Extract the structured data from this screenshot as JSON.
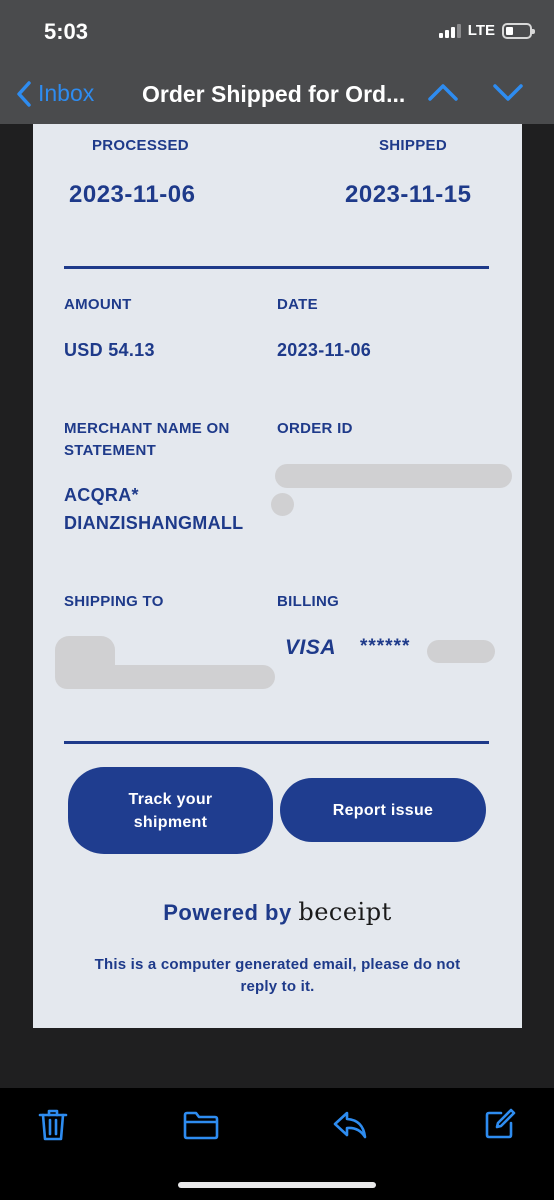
{
  "status_bar": {
    "time": "5:03",
    "network": "LTE"
  },
  "nav": {
    "back_label": "Inbox",
    "title": "Order Shipped for Ord..."
  },
  "email": {
    "processed": {
      "label": "PROCESSED",
      "value": "2023-11-06"
    },
    "shipped": {
      "label": "SHIPPED",
      "value": "2023-11-15"
    },
    "amount": {
      "label": "AMOUNT",
      "value": "USD 54.13"
    },
    "date": {
      "label": "DATE",
      "value": "2023-11-06"
    },
    "merchant": {
      "label_line1": "MERCHANT NAME ON",
      "label_line2": "STATEMENT",
      "value_line1": "ACQRA*",
      "value_line2": "DIANZISHANGMALL"
    },
    "order_id": {
      "label": "ORDER ID"
    },
    "shipping": {
      "label": "SHIPPING TO"
    },
    "billing": {
      "label": "BILLING",
      "card_brand": "VISA",
      "masked": "******"
    },
    "track_button": {
      "line1": "Track your",
      "line2": "shipment"
    },
    "report_button": "Report issue",
    "powered_by": {
      "text": "Powered by",
      "brand": "beceipt"
    },
    "footer_line1": "This is a computer generated email, please do not",
    "footer_line2": "reply to it."
  },
  "toolbar": {
    "icons": [
      "trash-icon",
      "folder-icon",
      "reply-icon",
      "compose-icon"
    ]
  },
  "colors": {
    "accent": "#2e8cf0",
    "brand_navy": "#1e3a8a",
    "button_navy": "#1f3d8f",
    "card_bg": "#e4e8ee",
    "header_bg": "#4a4b4d"
  }
}
